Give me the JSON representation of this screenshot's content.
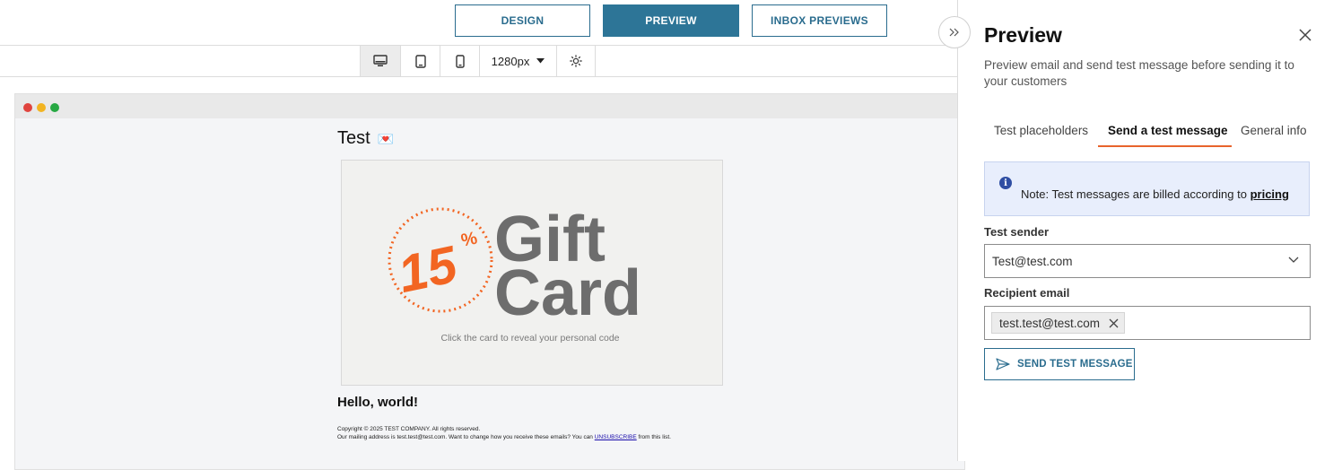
{
  "toolbar": {
    "design_label": "DESIGN",
    "preview_label": "PREVIEW",
    "inbox_label": "INBOX PREVIEWS"
  },
  "devices": {
    "width_value": "1280px"
  },
  "email": {
    "subject": "Test",
    "subject_emoji": "💌",
    "gift_card": {
      "percent": "15",
      "percent_sign": "%",
      "line1": "Gift",
      "line2": "Card",
      "caption": "Click the card to reveal your personal code"
    },
    "greeting": "Hello, world!",
    "footer_line1": "Copyright © 2025 TEST COMPANY. All rights reserved.",
    "footer_line2_pre": "Our mailing address is test.test@test.com. Want to change how you receive these emails? You can",
    "footer_link": "UNSUBSCRIBE",
    "footer_line2_post": "from this list."
  },
  "panel": {
    "title": "Preview",
    "description": "Preview email and send test message before sending it to your customers",
    "tabs": [
      "Test placeholders",
      "Send a test message",
      "General info"
    ],
    "active_tab": "Send a test message",
    "note_text": "Note: Test messages are billed according to",
    "note_link": "pricing",
    "sender_label": "Test sender",
    "sender_value": "Test@test.com",
    "recipient_label": "Recipient email",
    "recipient_value": "test.test@test.com",
    "send_button": "SEND TEST MESSAGE"
  },
  "colors": {
    "primary": "#2d7597",
    "tab_accent": "#e8642c",
    "gift_orange": "#f26522",
    "gift_gray": "#6d6d6d",
    "note_bg": "#e8eefc"
  }
}
